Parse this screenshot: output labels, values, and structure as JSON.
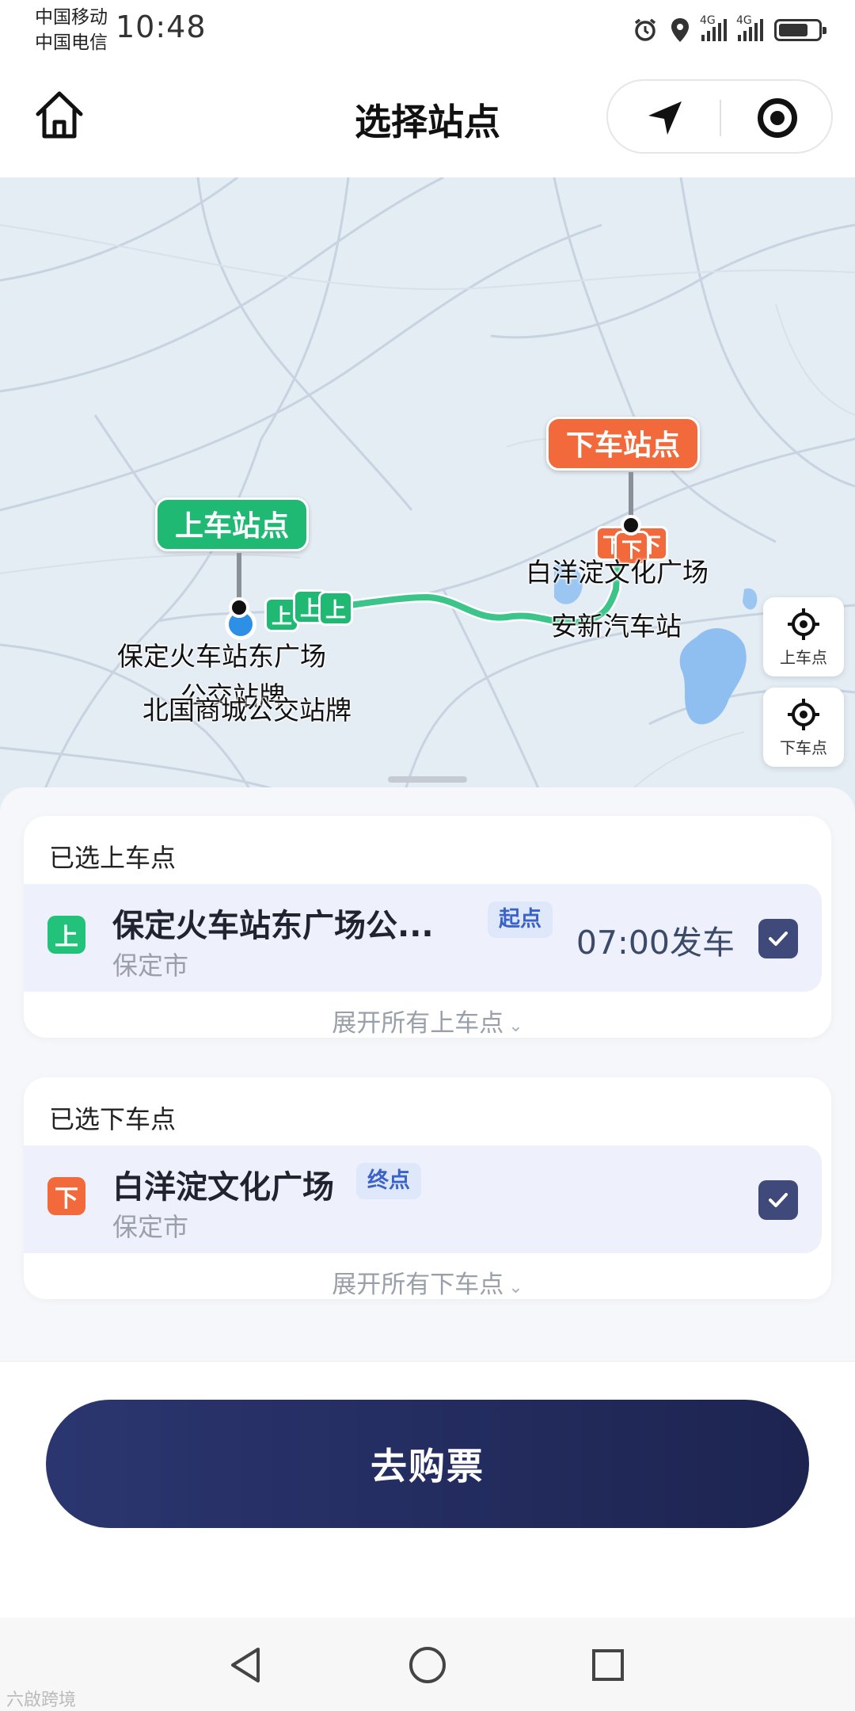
{
  "status_bar": {
    "carrier_1": "中国移动",
    "carrier_2": "中国电信",
    "time": "10:48",
    "network_1": "4G",
    "network_2": "4G",
    "icons": [
      "alarm-icon",
      "location-icon",
      "signal-icon",
      "battery-icon"
    ]
  },
  "header": {
    "title": "选择站点",
    "icons": [
      "home-icon",
      "navigation-arrow-icon",
      "target-icon"
    ]
  },
  "map": {
    "pickup_bubble": "上车站点",
    "dropoff_bubble": "下车站点",
    "marker_pickup": "上",
    "marker_dropoff": "下",
    "labels": {
      "pickup_station": "保定火车站东广场",
      "pickup_station_line2": "公交站牌",
      "nearby_station": "北国商城公交站牌",
      "dropoff_station": "白洋淀文化广场",
      "transit_station": "安新汽车站"
    },
    "locate_pickup_label": "上车点",
    "locate_dropoff_label": "下车点",
    "colors": {
      "pickup": "#1fb974",
      "dropoff": "#f26a3b",
      "route": "#3cc48a",
      "user_location": "#2e8fe6"
    }
  },
  "pickup_card": {
    "title": "已选上车点",
    "badge": "上",
    "name": "保定火车站东广场公...",
    "tag": "起点",
    "city": "保定市",
    "depart_time": "07:00发车",
    "checked": true,
    "expand_label": "展开所有上车点"
  },
  "dropoff_card": {
    "title": "已选下车点",
    "badge": "下",
    "name": "白洋淀文化广场",
    "tag": "终点",
    "city": "保定市",
    "checked": true,
    "expand_label": "展开所有下车点"
  },
  "action": {
    "buy_label": "去购票",
    "button_color": "#2b3670"
  },
  "nav": {
    "icons": [
      "back-triangle-icon",
      "home-circle-icon",
      "recents-square-icon"
    ]
  },
  "watermark": "六啟跨境"
}
